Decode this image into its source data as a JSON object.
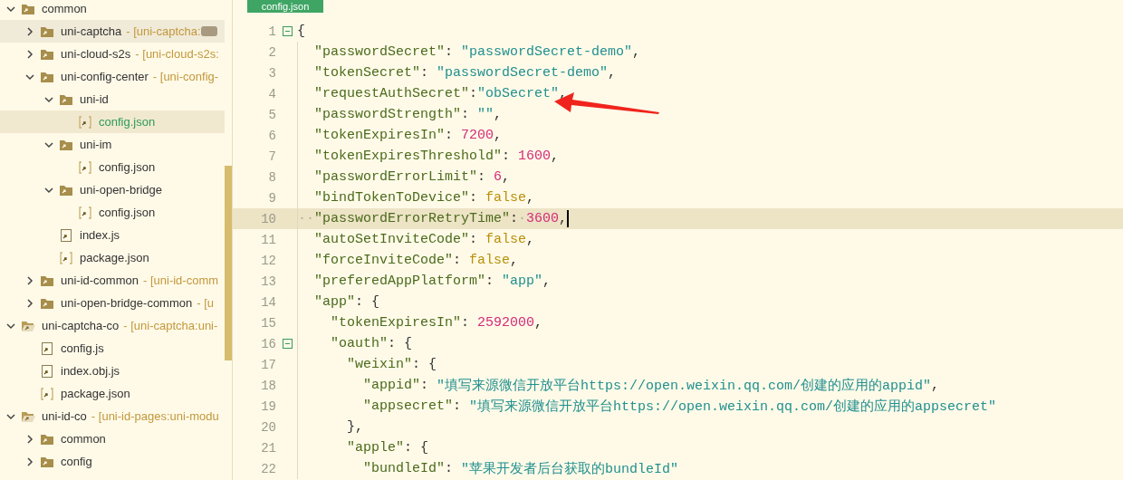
{
  "sidebar": {
    "tree": [
      {
        "name": "common",
        "kind": "folder",
        "expanded": true,
        "selected": false,
        "hovered": false,
        "children": [
          {
            "name": "uni-captcha",
            "detail": "- [uni-captcha:",
            "redacted": true,
            "kind": "folder",
            "expanded": false,
            "selected": false,
            "hovered": true
          },
          {
            "name": "uni-cloud-s2s",
            "detail": "- [uni-cloud-s2s:",
            "kind": "folder",
            "expanded": false,
            "selected": false,
            "hovered": false
          },
          {
            "name": "uni-config-center",
            "detail": "- [uni-config-",
            "kind": "folder",
            "expanded": true,
            "selected": false,
            "hovered": false,
            "children": [
              {
                "name": "uni-id",
                "kind": "folder",
                "expanded": true,
                "selected": false,
                "hovered": false,
                "children": [
                  {
                    "name": "config.json",
                    "kind": "json-file",
                    "selected": true,
                    "hovered": false
                  }
                ]
              },
              {
                "name": "uni-im",
                "kind": "folder",
                "expanded": true,
                "selected": false,
                "hovered": false,
                "children": [
                  {
                    "name": "config.json",
                    "kind": "json-file",
                    "selected": false,
                    "hovered": false
                  }
                ]
              },
              {
                "name": "uni-open-bridge",
                "kind": "folder",
                "expanded": true,
                "selected": false,
                "hovered": false,
                "children": [
                  {
                    "name": "config.json",
                    "kind": "json-file",
                    "selected": false,
                    "hovered": false
                  }
                ]
              },
              {
                "name": "index.js",
                "kind": "js-file",
                "selected": false,
                "hovered": false
              },
              {
                "name": "package.json",
                "kind": "json-file",
                "selected": false,
                "hovered": false
              }
            ]
          },
          {
            "name": "uni-id-common",
            "detail": "- [uni-id-comm",
            "kind": "folder",
            "expanded": false,
            "selected": false,
            "hovered": false
          },
          {
            "name": "uni-open-bridge-common",
            "detail": "- [u",
            "kind": "folder",
            "expanded": false,
            "selected": false,
            "hovered": false
          }
        ]
      },
      {
        "name": "uni-captcha-co",
        "detail": "- [uni-captcha:uni-",
        "kind": "module",
        "expanded": true,
        "selected": false,
        "hovered": false,
        "children": [
          {
            "name": "config.js",
            "kind": "js-file",
            "selected": false,
            "hovered": false
          },
          {
            "name": "index.obj.js",
            "kind": "js-file",
            "selected": false,
            "hovered": false
          },
          {
            "name": "package.json",
            "kind": "json-file",
            "selected": false,
            "hovered": false
          }
        ]
      },
      {
        "name": "uni-id-co",
        "detail": "- [uni-id-pages:uni-modu",
        "kind": "module",
        "expanded": true,
        "selected": false,
        "hovered": false,
        "children": [
          {
            "name": "common",
            "kind": "folder",
            "expanded": false,
            "selected": false,
            "hovered": false
          },
          {
            "name": "config",
            "kind": "folder",
            "expanded": false,
            "selected": false,
            "hovered": false
          }
        ]
      }
    ]
  },
  "tabs": [
    {
      "label": "config.json",
      "selected": true
    }
  ],
  "editor": {
    "lines": [
      {
        "number": "1",
        "fold": true,
        "current": false,
        "tokens": [
          {
            "kind": "punct",
            "text": "{"
          }
        ]
      },
      {
        "number": "2",
        "fold": false,
        "current": false,
        "tokens": [
          {
            "kind": "key",
            "text": "  \"passwordSecret\""
          },
          {
            "kind": "punct",
            "text": ": "
          },
          {
            "kind": "str",
            "text": "\"passwordSecret-demo\""
          },
          {
            "kind": "punct",
            "text": ","
          }
        ]
      },
      {
        "number": "3",
        "fold": false,
        "current": false,
        "tokens": [
          {
            "kind": "key",
            "text": "  \"tokenSecret\""
          },
          {
            "kind": "punct",
            "text": ": "
          },
          {
            "kind": "str",
            "text": "\"passwordSecret-demo\""
          },
          {
            "kind": "punct",
            "text": ","
          }
        ]
      },
      {
        "number": "4",
        "fold": false,
        "current": false,
        "tokens": [
          {
            "kind": "key",
            "text": "  \"requestAuthSecret\""
          },
          {
            "kind": "punct",
            "text": ":"
          },
          {
            "kind": "str",
            "text": "\"obSecret\""
          },
          {
            "kind": "punct",
            "text": ","
          }
        ]
      },
      {
        "number": "5",
        "fold": false,
        "current": false,
        "tokens": [
          {
            "kind": "key",
            "text": "  \"passwordStrength\""
          },
          {
            "kind": "punct",
            "text": ": "
          },
          {
            "kind": "str",
            "text": "\"\""
          },
          {
            "kind": "punct",
            "text": ","
          }
        ]
      },
      {
        "number": "6",
        "fold": false,
        "current": false,
        "tokens": [
          {
            "kind": "key",
            "text": "  \"tokenExpiresIn\""
          },
          {
            "kind": "punct",
            "text": ": "
          },
          {
            "kind": "num",
            "text": "7200"
          },
          {
            "kind": "punct",
            "text": ","
          }
        ]
      },
      {
        "number": "7",
        "fold": false,
        "current": false,
        "tokens": [
          {
            "kind": "key",
            "text": "  \"tokenExpiresThreshold\""
          },
          {
            "kind": "punct",
            "text": ": "
          },
          {
            "kind": "num",
            "text": "1600"
          },
          {
            "kind": "punct",
            "text": ","
          }
        ]
      },
      {
        "number": "8",
        "fold": false,
        "current": false,
        "tokens": [
          {
            "kind": "key",
            "text": "  \"passwordErrorLimit\""
          },
          {
            "kind": "punct",
            "text": ": "
          },
          {
            "kind": "num",
            "text": "6"
          },
          {
            "kind": "punct",
            "text": ","
          }
        ]
      },
      {
        "number": "9",
        "fold": false,
        "current": false,
        "tokens": [
          {
            "kind": "key",
            "text": "  \"bindTokenToDevice\""
          },
          {
            "kind": "punct",
            "text": ": "
          },
          {
            "kind": "bool",
            "text": "false"
          },
          {
            "kind": "punct",
            "text": ","
          }
        ]
      },
      {
        "number": "10",
        "fold": false,
        "current": true,
        "tokens": [
          {
            "kind": "ws",
            "text": "··"
          },
          {
            "kind": "key",
            "text": "\"passwordErrorRetryTime\""
          },
          {
            "kind": "punct",
            "text": ":"
          },
          {
            "kind": "ws",
            "text": "·"
          },
          {
            "kind": "num",
            "text": "3600"
          },
          {
            "kind": "punct",
            "text": ","
          }
        ]
      },
      {
        "number": "11",
        "fold": false,
        "current": false,
        "tokens": [
          {
            "kind": "key",
            "text": "  \"autoSetInviteCode\""
          },
          {
            "kind": "punct",
            "text": ": "
          },
          {
            "kind": "bool",
            "text": "false"
          },
          {
            "kind": "punct",
            "text": ","
          }
        ]
      },
      {
        "number": "12",
        "fold": false,
        "current": false,
        "tokens": [
          {
            "kind": "key",
            "text": "  \"forceInviteCode\""
          },
          {
            "kind": "punct",
            "text": ": "
          },
          {
            "kind": "bool",
            "text": "false"
          },
          {
            "kind": "punct",
            "text": ","
          }
        ]
      },
      {
        "number": "13",
        "fold": false,
        "current": false,
        "tokens": [
          {
            "kind": "key",
            "text": "  \"preferedAppPlatform\""
          },
          {
            "kind": "punct",
            "text": ": "
          },
          {
            "kind": "str",
            "text": "\"app\""
          },
          {
            "kind": "punct",
            "text": ","
          }
        ]
      },
      {
        "number": "14",
        "fold": false,
        "current": false,
        "tokens": [
          {
            "kind": "key",
            "text": "  \"app\""
          },
          {
            "kind": "punct",
            "text": ": {"
          }
        ]
      },
      {
        "number": "15",
        "fold": false,
        "current": false,
        "tokens": [
          {
            "kind": "key",
            "text": "    \"tokenExpiresIn\""
          },
          {
            "kind": "punct",
            "text": ": "
          },
          {
            "kind": "num",
            "text": "2592000"
          },
          {
            "kind": "punct",
            "text": ","
          }
        ]
      },
      {
        "number": "16",
        "fold": true,
        "current": false,
        "tokens": [
          {
            "kind": "key",
            "text": "    \"oauth\""
          },
          {
            "kind": "punct",
            "text": ": {"
          }
        ]
      },
      {
        "number": "17",
        "fold": false,
        "current": false,
        "tokens": [
          {
            "kind": "key",
            "text": "      \"weixin\""
          },
          {
            "kind": "punct",
            "text": ": {"
          }
        ]
      },
      {
        "number": "18",
        "fold": false,
        "current": false,
        "tokens": [
          {
            "kind": "key",
            "text": "        \"appid\""
          },
          {
            "kind": "punct",
            "text": ": "
          },
          {
            "kind": "str",
            "text": "\"填写来源微信开放平台https://open.weixin.qq.com/创建的应用的appid\""
          },
          {
            "kind": "punct",
            "text": ","
          }
        ]
      },
      {
        "number": "19",
        "fold": false,
        "current": false,
        "tokens": [
          {
            "kind": "key",
            "text": "        \"appsecret\""
          },
          {
            "kind": "punct",
            "text": ": "
          },
          {
            "kind": "str",
            "text": "\"填写来源微信开放平台https://open.weixin.qq.com/创建的应用的appsecret\""
          }
        ]
      },
      {
        "number": "20",
        "fold": false,
        "current": false,
        "tokens": [
          {
            "kind": "punct",
            "text": "      },"
          }
        ]
      },
      {
        "number": "21",
        "fold": false,
        "current": false,
        "tokens": [
          {
            "kind": "key",
            "text": "      \"apple\""
          },
          {
            "kind": "punct",
            "text": ": {"
          }
        ]
      },
      {
        "number": "22",
        "fold": false,
        "current": false,
        "tokens": [
          {
            "kind": "key",
            "text": "        \"bundleId\""
          },
          {
            "kind": "punct",
            "text": ": "
          },
          {
            "kind": "str",
            "text": "\"苹果开发者后台获取的bundleId\""
          }
        ]
      }
    ]
  }
}
